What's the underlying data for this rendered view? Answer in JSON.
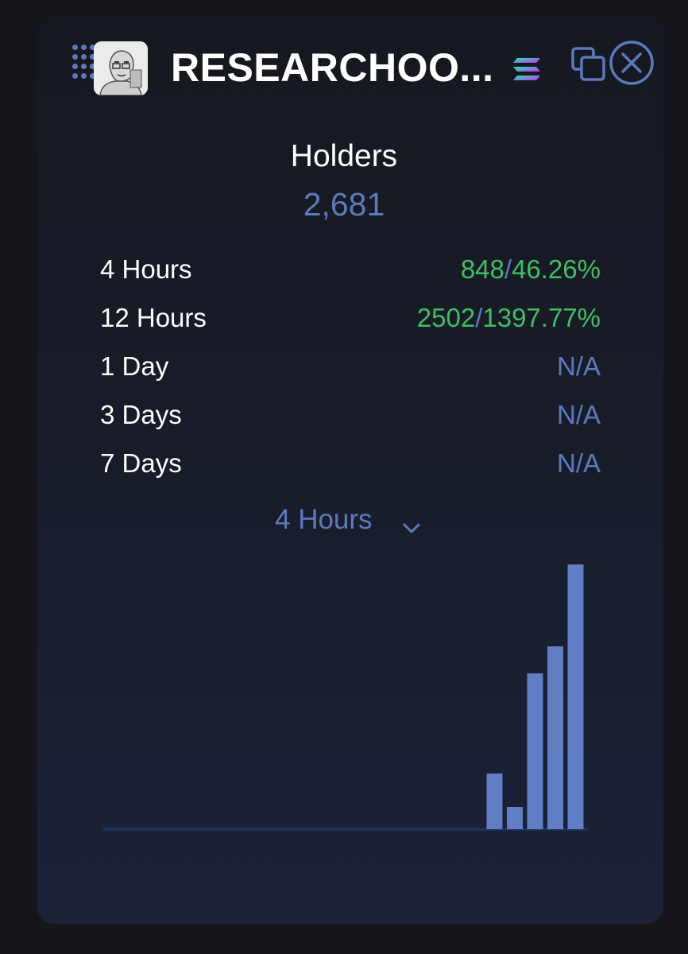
{
  "header": {
    "title": "RESEARCHOO...",
    "icons": [
      "drag-handle-icon",
      "avatar-image",
      "solana-icon",
      "copy-icon",
      "close-icon"
    ]
  },
  "holders": {
    "label": "Holders",
    "count": "2,681"
  },
  "stats": [
    {
      "label": "4 Hours",
      "count": "848",
      "sep": "/",
      "pct": "46.26%",
      "na": ""
    },
    {
      "label": "12 Hours",
      "count": "2502",
      "sep": "/",
      "pct": "1397.77%",
      "na": ""
    },
    {
      "label": "1 Day",
      "count": "",
      "sep": "",
      "pct": "",
      "na": "N/A"
    },
    {
      "label": "3 Days",
      "count": "",
      "sep": "",
      "pct": "",
      "na": "N/A"
    },
    {
      "label": "7 Days",
      "count": "",
      "sep": "",
      "pct": "",
      "na": "N/A"
    }
  ],
  "range_select": {
    "value": "4 Hours"
  },
  "colors": {
    "accent": "#5b79bd",
    "positive": "#3fbf63",
    "bar": "#5f7ec4"
  },
  "chart_data": {
    "type": "bar",
    "values": [
      0,
      0,
      0,
      0,
      0,
      0,
      0,
      0,
      0,
      0,
      0,
      0,
      0,
      0,
      0,
      0,
      0,
      0,
      0,
      70,
      28,
      196,
      230,
      333
    ],
    "ylim": [
      0,
      333
    ]
  }
}
